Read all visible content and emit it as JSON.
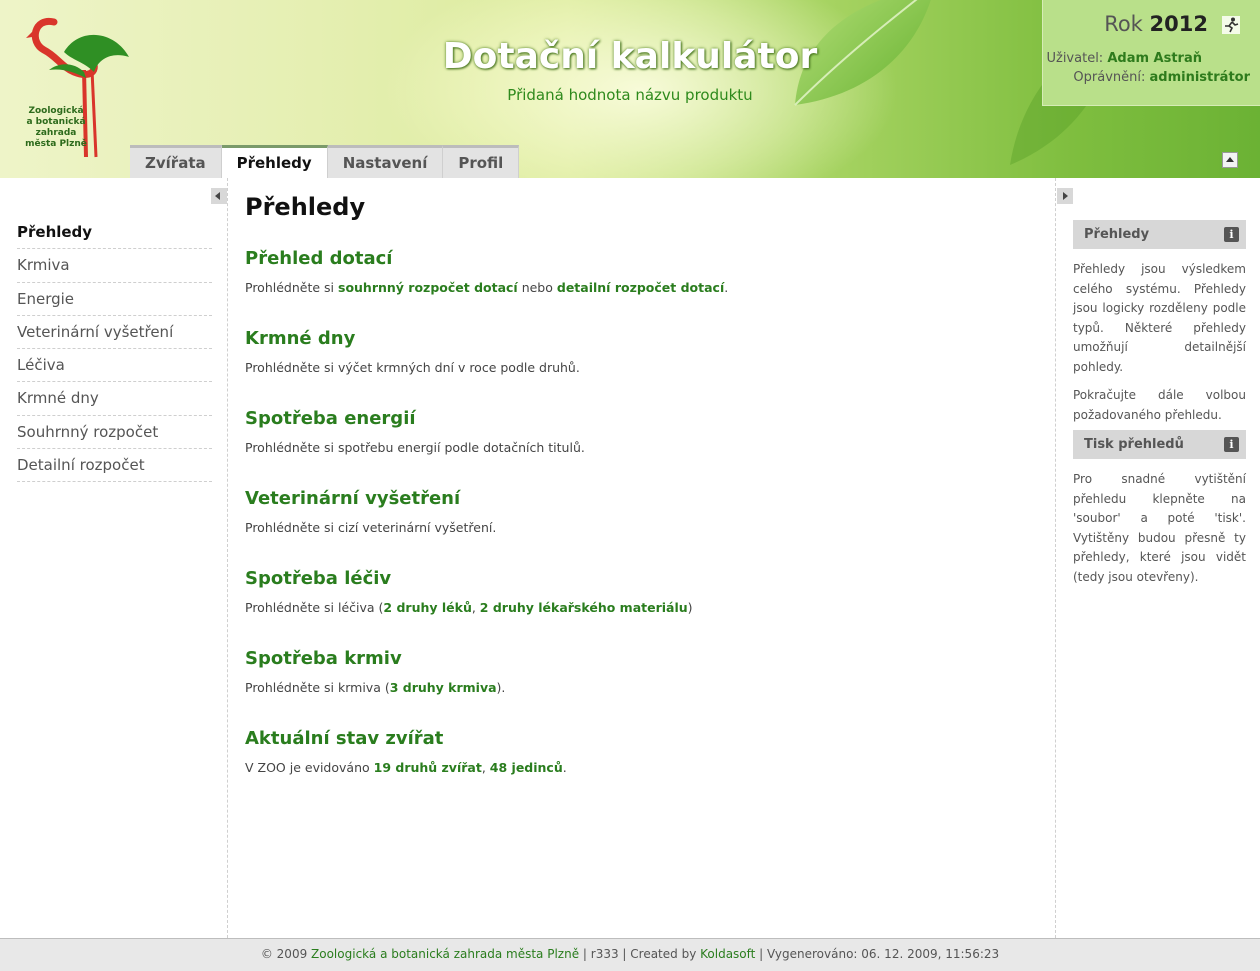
{
  "header": {
    "title": "Dotační kalkulátor",
    "subtitle": "Přidaná hodnota názvu produktu",
    "logo_text": [
      "Zoologická",
      "a botanická",
      "zahrada",
      "města Plzně"
    ]
  },
  "userbox": {
    "year_label": "Rok",
    "year_value": "2012",
    "user_label": "Uživatel:",
    "user_name": "Adam  Astraň",
    "role_label": "Oprávnění:",
    "role_value": "administrátor"
  },
  "tabs": [
    {
      "label": "Zvířata",
      "active": false
    },
    {
      "label": "Přehledy",
      "active": true
    },
    {
      "label": "Nastavení",
      "active": false
    },
    {
      "label": "Profil",
      "active": false
    }
  ],
  "sidebar": {
    "items": [
      {
        "label": "Přehledy",
        "active": true
      },
      {
        "label": "Krmiva"
      },
      {
        "label": "Energie"
      },
      {
        "label": "Veterinární vyšetření"
      },
      {
        "label": "Léčiva"
      },
      {
        "label": "Krmné dny"
      },
      {
        "label": "Souhrnný rozpočet"
      },
      {
        "label": "Detailní rozpočet"
      }
    ]
  },
  "main": {
    "title": "Přehledy",
    "sections": [
      {
        "heading": "Přehled dotací",
        "text_before": "Prohlédněte si ",
        "link1": "souhrnný rozpočet dotací",
        "text_mid": " nebo ",
        "link2": "detailní rozpočet dotací",
        "text_after": "."
      },
      {
        "heading": "Krmné dny",
        "text": "Prohlédněte si výčet krmných dní v roce podle druhů."
      },
      {
        "heading": "Spotřeba energií",
        "text": "Prohlédněte si spotřebu energií podle dotačních titulů."
      },
      {
        "heading": "Veterinární vyšetření",
        "text": "Prohlédněte si cizí veterinární vyšetření."
      },
      {
        "heading": "Spotřeba léčiv",
        "text_before": "Prohlédněte si léčiva (",
        "link1": "2 druhy léků",
        "text_mid": ", ",
        "link2": "2 druhy lékařského materiálu",
        "text_after": ")"
      },
      {
        "heading": "Spotřeba krmiv",
        "text_before": "Prohlédněte si krmiva (",
        "link1": "3 druhy krmiva",
        "text_after": ")."
      },
      {
        "heading": "Aktuální stav zvířat",
        "text_before": "V ZOO je evidováno ",
        "link1": "19 druhů zvířat",
        "text_mid": ", ",
        "link2": "48 jedinců",
        "text_after": "."
      }
    ]
  },
  "right": {
    "boxes": [
      {
        "title": "Přehledy",
        "paragraphs": [
          "Přehledy jsou výsledkem celého systému. Přehledy jsou logicky rozděleny podle typů. Některé přehledy umožňují detailnější pohledy.",
          "Pokračujte dále volbou požadovaného přehledu."
        ]
      },
      {
        "title": "Tisk přehledů",
        "paragraphs": [
          "Pro snadné vytištění přehledu klepněte na 'soubor' a poté 'tisk'. Vytištěny budou přesně ty přehledy, které jsou vidět (tedy jsou otevřeny)."
        ]
      }
    ]
  },
  "footer": {
    "copyright": "© 2009 ",
    "org_link": "Zoologická a botanická zahrada města Plzně",
    "revision": " | r333 | Created by ",
    "company_link": "Koldasoft",
    "generated": " | Vygenerováno: 06. 12. 2009, 11:56:23"
  },
  "colors": {
    "accent_green": "#2a7d1e",
    "header_green": "#7fbe3f",
    "userbox_bg": "#b9e08a"
  },
  "icons": [
    "logout-icon",
    "info-icon",
    "collapse-header-icon",
    "collapse-left-icon",
    "collapse-right-icon",
    "flamingo-logo"
  ]
}
